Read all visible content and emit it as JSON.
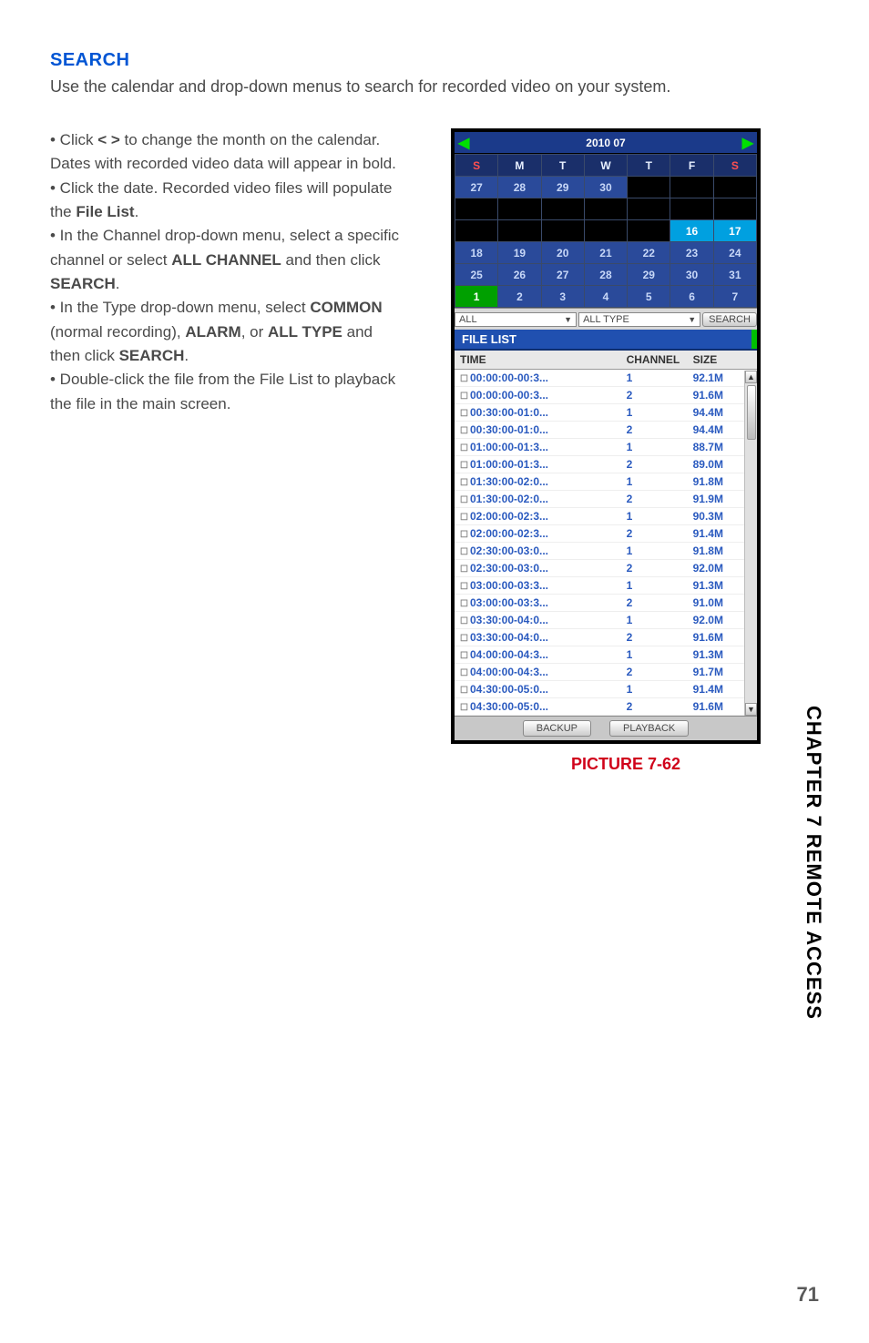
{
  "heading": "SEARCH",
  "intro": "Use the calendar and drop-down menus to search for recorded video on your system.",
  "bullets": {
    "b1a": "• Click ",
    "b1_sym": "< >",
    "b1b": " to change the month on the calendar. Dates with recorded video data will appear in bold.",
    "b2a": "• Click the date. Recorded video files will populate the ",
    "b2_bold": "File List",
    "b2b": ".",
    "b3a": "• In the Channel drop-down menu, select a specific channel or select ",
    "b3_bold1": "ALL CHANNEL",
    "b3b": " and then click ",
    "b3_bold2": "SEARCH",
    "b3c": ".",
    "b4a": "• In the Type drop-down menu, select ",
    "b4_bold1": "COMMON",
    "b4b": " (normal recording), ",
    "b4_bold2": "ALARM",
    "b4c": ", or ",
    "b4_bold3": "ALL TYPE",
    "b4d": " and then click ",
    "b4_bold4": "SEARCH",
    "b4e": ".",
    "b5": "• Double-click the file from the File List to playback the file in the main screen."
  },
  "caption": "PICTURE 7-62",
  "side_tab": {
    "ch": "CHAPTER 7",
    "ra": " REMOTE ACCESS"
  },
  "page_num": "71",
  "calendar": {
    "title": "2010 07",
    "dow": [
      "S",
      "M",
      "T",
      "W",
      "T",
      "F",
      "S"
    ],
    "rows": [
      [
        "27",
        "28",
        "29",
        "30",
        "",
        "",
        ""
      ],
      [
        "",
        "",
        "",
        "",
        "",
        "",
        ""
      ],
      [
        "",
        "",
        "",
        "",
        "",
        "16",
        "17"
      ],
      [
        "18",
        "19",
        "20",
        "21",
        "22",
        "23",
        "24"
      ],
      [
        "25",
        "26",
        "27",
        "28",
        "29",
        "30",
        "31"
      ],
      [
        "1",
        "2",
        "3",
        "4",
        "5",
        "6",
        "7"
      ]
    ]
  },
  "filter": {
    "channel": "ALL",
    "type": "ALL TYPE",
    "search": "SEARCH"
  },
  "tab_label": "FILE LIST",
  "file_headers": {
    "time": "TIME",
    "channel": "CHANNEL",
    "size": "SIZE"
  },
  "files": [
    {
      "t": "00:00:00-00:3...",
      "c": "1",
      "s": "92.1M"
    },
    {
      "t": "00:00:00-00:3...",
      "c": "2",
      "s": "91.6M"
    },
    {
      "t": "00:30:00-01:0...",
      "c": "1",
      "s": "94.4M"
    },
    {
      "t": "00:30:00-01:0...",
      "c": "2",
      "s": "94.4M"
    },
    {
      "t": "01:00:00-01:3...",
      "c": "1",
      "s": "88.7M"
    },
    {
      "t": "01:00:00-01:3...",
      "c": "2",
      "s": "89.0M"
    },
    {
      "t": "01:30:00-02:0...",
      "c": "1",
      "s": "91.8M"
    },
    {
      "t": "01:30:00-02:0...",
      "c": "2",
      "s": "91.9M"
    },
    {
      "t": "02:00:00-02:3...",
      "c": "1",
      "s": "90.3M"
    },
    {
      "t": "02:00:00-02:3...",
      "c": "2",
      "s": "91.4M"
    },
    {
      "t": "02:30:00-03:0...",
      "c": "1",
      "s": "91.8M"
    },
    {
      "t": "02:30:00-03:0...",
      "c": "2",
      "s": "92.0M"
    },
    {
      "t": "03:00:00-03:3...",
      "c": "1",
      "s": "91.3M"
    },
    {
      "t": "03:00:00-03:3...",
      "c": "2",
      "s": "91.0M"
    },
    {
      "t": "03:30:00-04:0...",
      "c": "1",
      "s": "92.0M"
    },
    {
      "t": "03:30:00-04:0...",
      "c": "2",
      "s": "91.6M"
    },
    {
      "t": "04:00:00-04:3...",
      "c": "1",
      "s": "91.3M"
    },
    {
      "t": "04:00:00-04:3...",
      "c": "2",
      "s": "91.7M"
    },
    {
      "t": "04:30:00-05:0...",
      "c": "1",
      "s": "91.4M"
    },
    {
      "t": "04:30:00-05:0...",
      "c": "2",
      "s": "91.6M"
    }
  ],
  "buttons": {
    "backup": "BACKUP",
    "playback": "PLAYBACK"
  }
}
